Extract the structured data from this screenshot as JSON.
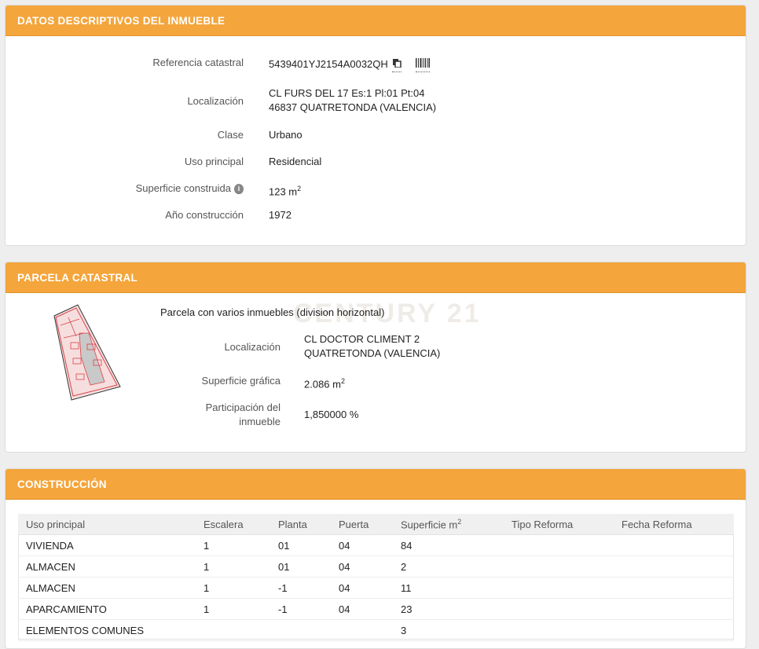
{
  "datos": {
    "title": "DATOS DESCRIPTIVOS DEL INMUEBLE",
    "ref_label": "Referencia catastral",
    "ref_value": "5439401YJ2154A0032QH",
    "loc_label": "Localización",
    "loc_line1": "CL FURS DEL 17 Es:1 Pl:01 Pt:04",
    "loc_line2": "46837 QUATRETONDA (VALENCIA)",
    "clase_label": "Clase",
    "clase_value": "Urbano",
    "uso_label": "Uso principal",
    "uso_value": "Residencial",
    "sup_label": "Superficie construida",
    "sup_value": "123 m",
    "sup_unit_exp": "2",
    "anio_label": "Año construcción",
    "anio_value": "1972"
  },
  "parcela": {
    "title": "PARCELA CATASTRAL",
    "desc": "Parcela con varios inmuebles (division horizontal)",
    "loc_label": "Localización",
    "loc_line1": "CL DOCTOR CLIMENT 2",
    "loc_line2": "QUATRETONDA (VALENCIA)",
    "sup_label": "Superficie gráfica",
    "sup_value": "2.086 m",
    "sup_unit_exp": "2",
    "part_label_1": "Participación del",
    "part_label_2": "inmueble",
    "part_value": "1,850000 %",
    "watermark": "CENTURY 21"
  },
  "construccion": {
    "title": "CONSTRUCCIÓN",
    "headers": [
      "Uso principal",
      "Escalera",
      "Planta",
      "Puerta",
      "Superficie m",
      "Tipo Reforma",
      "Fecha Reforma"
    ],
    "sup_header_exp": "2",
    "rows": [
      [
        "VIVIENDA",
        "1",
        "01",
        "04",
        "84",
        "",
        ""
      ],
      [
        "ALMACEN",
        "1",
        "01",
        "04",
        "2",
        "",
        ""
      ],
      [
        "ALMACEN",
        "1",
        "-1",
        "04",
        "11",
        "",
        ""
      ],
      [
        "APARCAMIENTO",
        "1",
        "-1",
        "04",
        "23",
        "",
        ""
      ],
      [
        "ELEMENTOS COMUNES",
        "",
        "",
        "",
        "3",
        "",
        ""
      ]
    ]
  },
  "colors": {
    "header": "#f4a53b",
    "parcel_fill": "#f7dede",
    "parcel_stroke": "#d9434a"
  },
  "icons": {
    "copy": "copy-icon",
    "barcode": "barcode-icon",
    "info": "info-icon"
  }
}
